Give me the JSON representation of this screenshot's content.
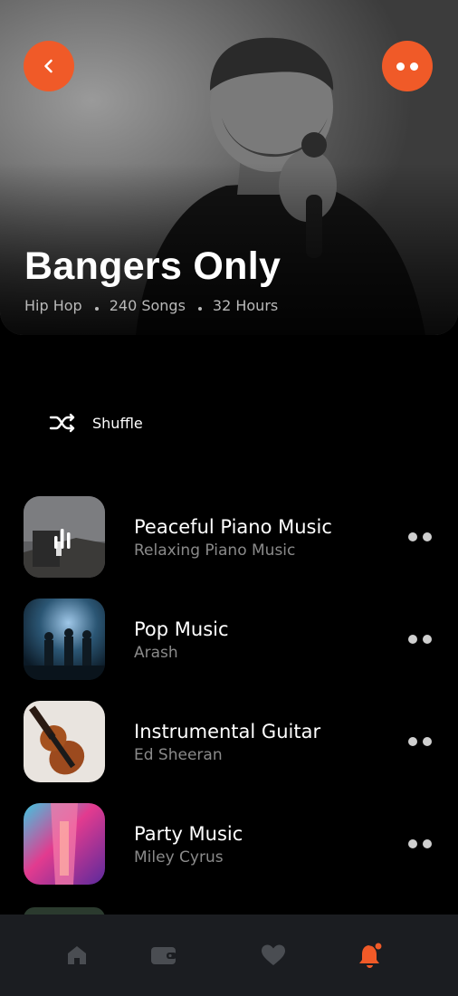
{
  "header": {
    "back_icon": "chevron-left-icon",
    "more_icon": "more-dots-icon",
    "accent_color": "#f05a28"
  },
  "playlist": {
    "title": "Bangers Only",
    "genre": "Hip Hop",
    "songs": "240 Songs",
    "hours": "32 Hours"
  },
  "shuffle": {
    "label": "Shuffle",
    "icon": "shuffle-icon"
  },
  "tracks": [
    {
      "title": "Peaceful Piano Music",
      "artist": "Relaxing Piano Music",
      "playing": true
    },
    {
      "title": "Pop Music",
      "artist": "Arash",
      "playing": false
    },
    {
      "title": "Instrumental Guitar",
      "artist": "Ed Sheeran",
      "playing": false
    },
    {
      "title": "Party Music",
      "artist": "Miley Cyrus",
      "playing": false
    }
  ],
  "nav": {
    "items": [
      {
        "icon": "home-icon",
        "active": false
      },
      {
        "icon": "wallet-icon",
        "active": false
      },
      {
        "icon": "heart-icon",
        "active": false
      },
      {
        "icon": "bell-icon",
        "active": true,
        "has_badge": true
      }
    ]
  }
}
